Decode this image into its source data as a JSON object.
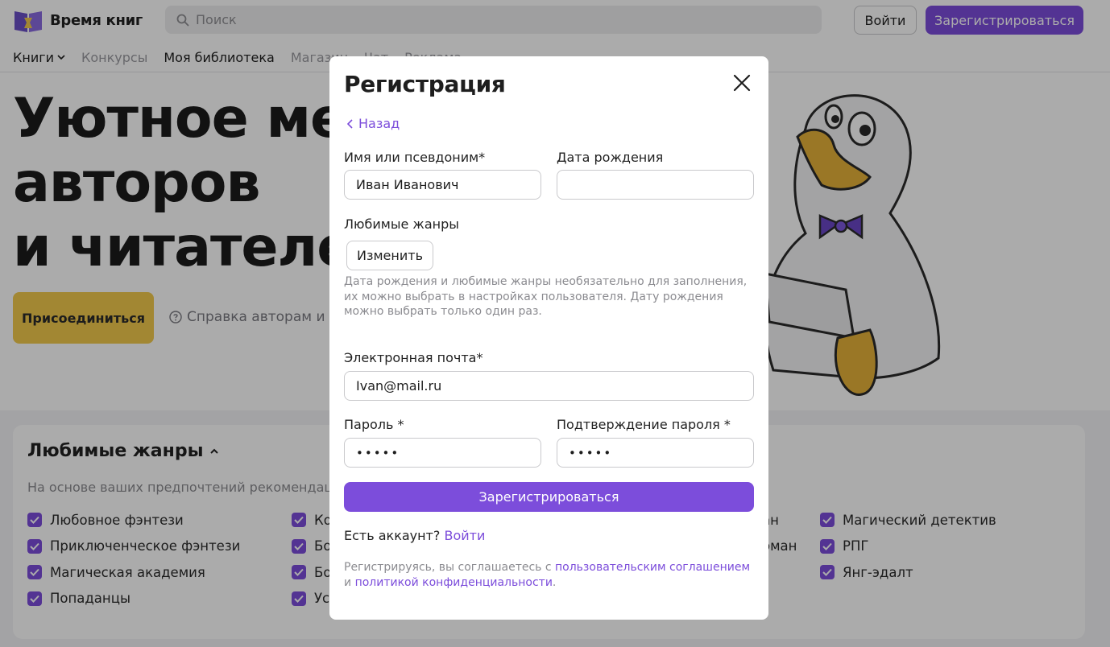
{
  "header": {
    "logo_text": "Время книг",
    "search_placeholder": "Поиск",
    "login_label": "Войти",
    "register_label": "Зарегистрироваться"
  },
  "nav": {
    "items": [
      "Книги",
      "Конкурсы",
      "Моя библиотека",
      "Магазин",
      "Чат",
      "Реклама"
    ]
  },
  "hero": {
    "title_lines": [
      "Уютное место для",
      "авторов",
      "и читателей"
    ],
    "join_label": "Присоединиться",
    "help_label": "Справка авторам и читателям"
  },
  "genres": {
    "title": "Любимые жанры",
    "subtitle": "На основе ваших предпочтений рекомендации",
    "col1": [
      "Любовное фэнтези",
      "Приключенческое фэнтези",
      "Магическая академия",
      "Попаданцы"
    ],
    "col2": [
      "Ко",
      "Бо",
      "Бо",
      "Ус"
    ],
    "col3": [
      "ан",
      "оман"
    ],
    "col4": [
      "Магический детектив",
      "РПГ",
      "Янг-эдалт"
    ]
  },
  "modal": {
    "title": "Регистрация",
    "back_label": "Назад",
    "name_label": "Имя или псевдоним*",
    "name_value": "Иван Иванович",
    "birth_label": "Дата рождения",
    "birth_value": "",
    "genres_label": "Любимые жанры",
    "change_label": "Изменить",
    "hint": "Дата рождения и любимые жанры необязательно для заполнения, их можно выбрать в настройках пользователя. Дату рождения можно выбрать только один раз.",
    "email_label": "Электронная почта*",
    "email_value": "Ivan@mail.ru",
    "password_label": "Пароль *",
    "password_value": "•••••",
    "confirm_label": "Подтверждение пароля *",
    "confirm_value": "•••••",
    "submit_label": "Зарегистрироваться",
    "account_prefix": "Есть аккаунт?",
    "account_login": "Войти",
    "terms_prefix": "Регистрируясь, вы соглашаетесь с",
    "terms_link": "пользовательским соглашением",
    "terms_and": "и",
    "privacy_link": "политикой конфиденциальности",
    "terms_end": "."
  },
  "colors": {
    "accent": "#7c4ddb",
    "join_button": "#f2c94c",
    "overlay": "#000000"
  }
}
